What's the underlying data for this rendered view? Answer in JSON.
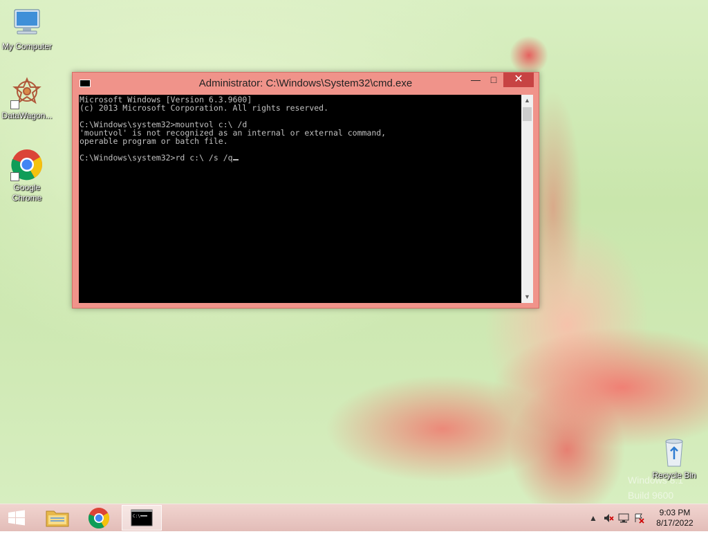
{
  "desktop": {
    "icons": [
      {
        "label": "My Computer",
        "icon": "computer-icon"
      },
      {
        "label": "DataWagon...",
        "icon": "datawagon-icon"
      },
      {
        "label": "Google Chrome",
        "icon": "chrome-icon"
      },
      {
        "label": "Recycle Bin",
        "icon": "recycle-bin-icon"
      }
    ],
    "watermark": [
      "Windows 8.1",
      "Build 9600"
    ]
  },
  "cmd_window": {
    "title": "Administrator: C:\\Windows\\System32\\cmd.exe",
    "controls": {
      "minimize": "—",
      "maximize": "□",
      "close": "✕"
    },
    "console_lines": [
      "Microsoft Windows [Version 6.3.9600]",
      "(c) 2013 Microsoft Corporation. All rights reserved.",
      "",
      "C:\\Windows\\system32>mountvol c:\\ /d",
      "'mountvol' is not recognized as an internal or external command,",
      "operable program or batch file.",
      "",
      "C:\\Windows\\system32>rd c:\\ /s /q"
    ]
  },
  "taskbar": {
    "items": [
      {
        "name": "start",
        "icon": "windows-start-icon"
      },
      {
        "name": "file-explorer",
        "icon": "folder-icon"
      },
      {
        "name": "chrome",
        "icon": "chrome-icon"
      },
      {
        "name": "cmd",
        "icon": "cmd-icon",
        "active": true
      }
    ],
    "tray": {
      "time": "9:03 PM",
      "date": "8/17/2022",
      "icons": [
        "chevron-up-icon",
        "volume-muted-icon",
        "network-icon",
        "action-center-icon"
      ]
    }
  },
  "colors": {
    "window_frame": "#f0938a",
    "close_button": "#c74343",
    "console_bg": "#000000",
    "console_fg": "#c0c0c0"
  }
}
